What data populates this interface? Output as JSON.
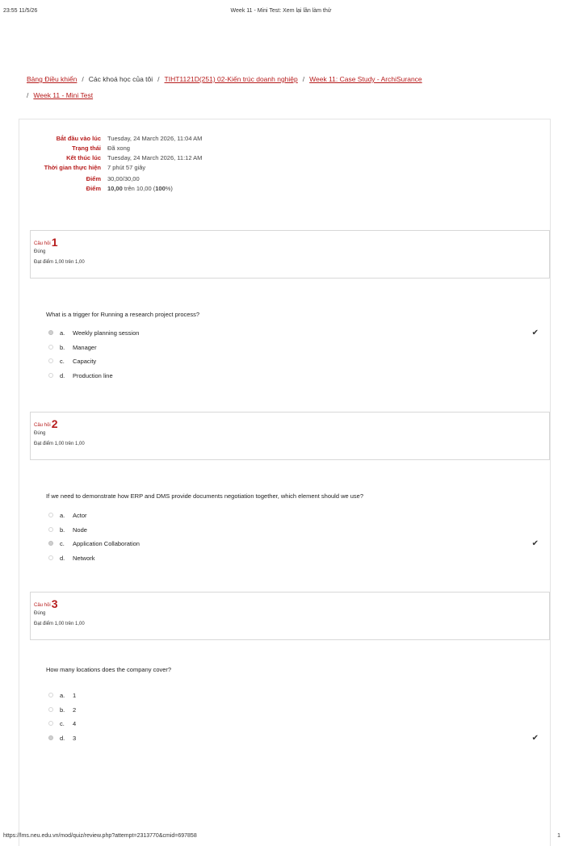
{
  "print_header": {
    "datetime": "23:55 11/5/26",
    "title": "Week 11 - Mini Test: Xem lại lần làm thử"
  },
  "breadcrumb": [
    {
      "label": "Bảng Điều khiển",
      "link": true
    },
    {
      "label": "Các khoá học của tôi",
      "link": false
    },
    {
      "label": "TIHT1121D(251) 02-Kiến trúc doanh nghiệp",
      "link": true
    },
    {
      "label": "Week 11: Case Study - ArchiSurance",
      "link": true
    },
    {
      "label": "Week 11 - Mini Test",
      "link": true
    }
  ],
  "summary": [
    {
      "label": "Bắt đầu vào lúc",
      "value": "Tuesday, 24 March 2026, 11:04 AM"
    },
    {
      "label": "Trạng thái",
      "value": "Đã xong"
    },
    {
      "label": "Kết thúc lúc",
      "value": "Tuesday, 24 March 2026, 11:12 AM"
    },
    {
      "label": "Thời gian thực hiện",
      "value": "7 phút 57 giây"
    },
    {
      "label": "Điểm",
      "value": "30,00/30,00"
    },
    {
      "label": "Điểm",
      "value_bold": "10,00",
      "value_rest": " trên 10,00 (",
      "value_pct": "100",
      "value_end": "%)"
    }
  ],
  "questions": [
    {
      "label": "Câu hỏi",
      "number": "1",
      "state": "Đúng",
      "grade": "Đạt điểm 1,00 trên 1,00",
      "text": "What is a trigger for Running a research project process?",
      "answers": [
        {
          "letter": "a.",
          "text": "Weekly planning session",
          "selected": true,
          "correct": true
        },
        {
          "letter": "b.",
          "text": "Manager",
          "selected": false,
          "correct": false
        },
        {
          "letter": "c.",
          "text": "Capacity",
          "selected": false,
          "correct": false
        },
        {
          "letter": "d.",
          "text": "Production line",
          "selected": false,
          "correct": false
        }
      ]
    },
    {
      "label": "Câu hỏi",
      "number": "2",
      "state": "Đúng",
      "grade": "Đạt điểm 1,00 trên 1,00",
      "text": "If we need to demonstrate how ERP and DMS provide documents negotiation together, which element should we use?",
      "answers": [
        {
          "letter": "a.",
          "text": "Actor",
          "selected": false,
          "correct": false
        },
        {
          "letter": "b.",
          "text": "Node",
          "selected": false,
          "correct": false
        },
        {
          "letter": "c.",
          "text": "Application Collaboration",
          "selected": true,
          "correct": true
        },
        {
          "letter": "d.",
          "text": "Network",
          "selected": false,
          "correct": false
        }
      ]
    },
    {
      "label": "Câu hỏi",
      "number": "3",
      "state": "Đúng",
      "grade": "Đạt điểm 1,00 trên 1,00",
      "text": "How many locations does the company cover?",
      "answers": [
        {
          "letter": "a.",
          "text": "1",
          "selected": false,
          "correct": false
        },
        {
          "letter": "b.",
          "text": "2",
          "selected": false,
          "correct": false
        },
        {
          "letter": "c.",
          "text": "4",
          "selected": false,
          "correct": false
        },
        {
          "letter": "d.",
          "text": "3",
          "selected": true,
          "correct": true
        }
      ]
    }
  ],
  "print_footer": {
    "url": "https://lms.neu.edu.vn/mod/quiz/review.php?attempt=2313770&cmid=697858",
    "page_number": "1"
  },
  "colors": {
    "accent": "#b71c1c",
    "border": "#d8d8d8"
  },
  "icons": {
    "correct": "check-icon"
  }
}
